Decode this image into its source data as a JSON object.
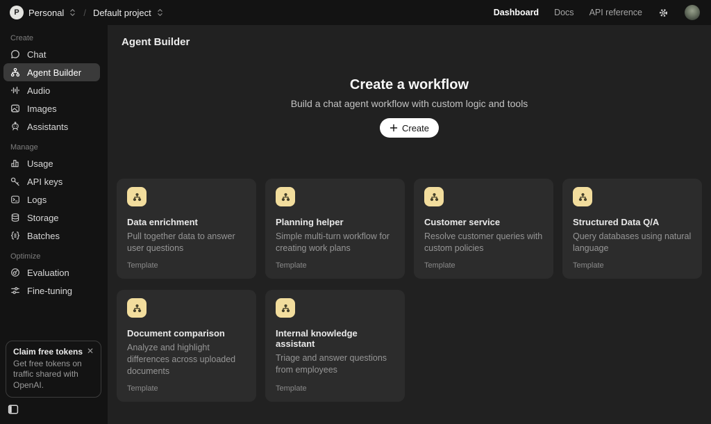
{
  "colors": {
    "accent_yellow": "#f2dd9d",
    "panel_bg": "#131313",
    "main_bg": "#212121",
    "card_bg": "#2c2c2c"
  },
  "topbar": {
    "org_avatar_letter": "P",
    "org_name": "Personal",
    "separator": "/",
    "project_name": "Default project",
    "nav": [
      {
        "label": "Dashboard",
        "active": true
      },
      {
        "label": "Docs",
        "active": false
      },
      {
        "label": "API reference",
        "active": false
      }
    ]
  },
  "sidebar": {
    "sections": [
      {
        "label": "Create",
        "items": [
          {
            "label": "Chat"
          },
          {
            "label": "Agent Builder",
            "active": true
          },
          {
            "label": "Audio"
          },
          {
            "label": "Images"
          },
          {
            "label": "Assistants"
          }
        ]
      },
      {
        "label": "Manage",
        "items": [
          {
            "label": "Usage"
          },
          {
            "label": "API keys"
          },
          {
            "label": "Logs"
          },
          {
            "label": "Storage"
          },
          {
            "label": "Batches"
          }
        ]
      },
      {
        "label": "Optimize",
        "items": [
          {
            "label": "Evaluation"
          },
          {
            "label": "Fine-tuning"
          }
        ]
      }
    ],
    "promo": {
      "title": "Claim free tokens",
      "close_label": "✕",
      "body": "Get free tokens on traffic shared with OpenAI."
    }
  },
  "main": {
    "page_title": "Agent Builder",
    "hero": {
      "title": "Create a workflow",
      "subtitle": "Build a chat agent workflow with custom logic and tools",
      "create_button": "Create"
    },
    "cards": [
      {
        "title": "Data enrichment",
        "description": "Pull together data to answer user questions",
        "badge": "Template"
      },
      {
        "title": "Planning helper",
        "description": "Simple multi-turn workflow for creating work plans",
        "badge": "Template"
      },
      {
        "title": "Customer service",
        "description": "Resolve customer queries with custom policies",
        "badge": "Template"
      },
      {
        "title": "Structured Data Q/A",
        "description": "Query databases using natural language",
        "badge": "Template"
      },
      {
        "title": "Document comparison",
        "description": "Analyze and highlight differences across uploaded documents",
        "badge": "Template"
      },
      {
        "title": "Internal knowledge assistant",
        "description": "Triage and answer questions from employees",
        "badge": "Template"
      }
    ]
  }
}
